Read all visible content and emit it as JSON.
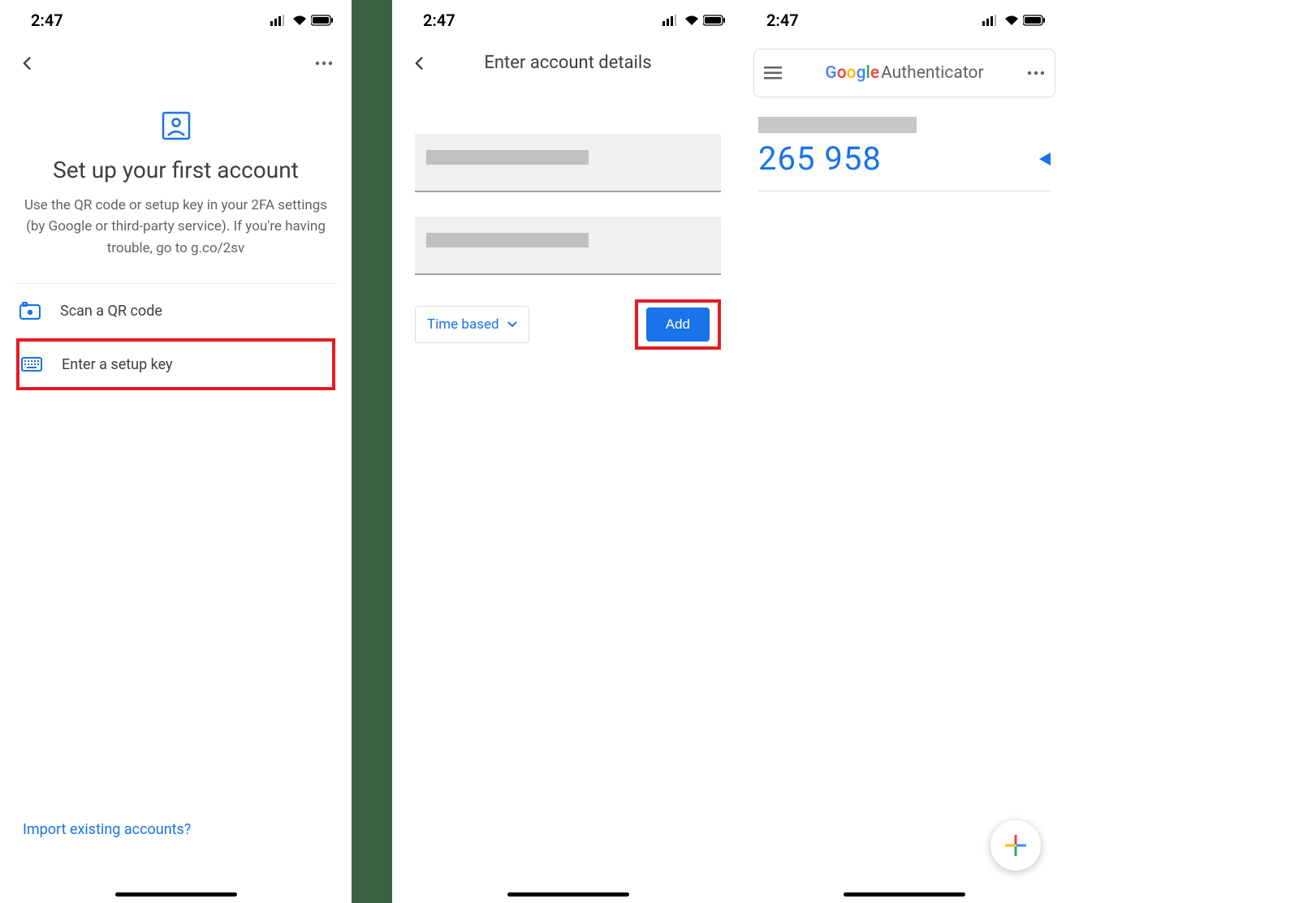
{
  "screen1": {
    "time": "2:47",
    "heading": "Set up your first account",
    "description": "Use the QR code or setup key in your 2FA settings (by Google or third-party service). If you're having trouble, go to g.co/2sv",
    "options": {
      "scan": "Scan a QR code",
      "key": "Enter a setup key"
    },
    "import_link": "Import existing accounts?"
  },
  "screen2": {
    "time": "2:47",
    "title": "Enter account details",
    "dropdown": "Time based",
    "add_button": "Add"
  },
  "screen3": {
    "time": "2:47",
    "brand_word": "Authenticator",
    "code": "265 958"
  }
}
